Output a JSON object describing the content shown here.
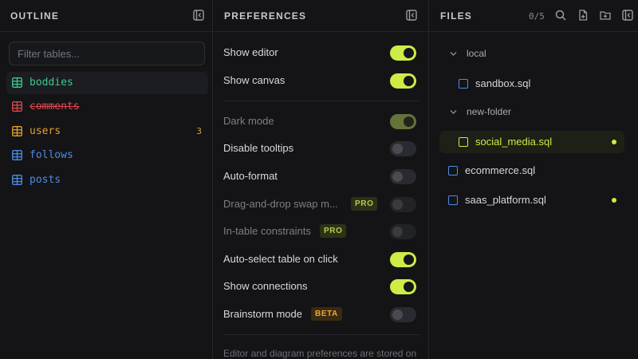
{
  "colors": {
    "background": "#141416",
    "accent": "#cdec46",
    "table_icon_green": "#3ec78a",
    "table_icon_red": "#e0484e",
    "table_icon_orange": "#e0a030",
    "table_icon_blue": "#4d8be8",
    "file_icon_blue": "#4d8be8",
    "pro_badge": "#b6c94e",
    "beta_badge": "#f0a43a"
  },
  "outline": {
    "title": "OUTLINE",
    "collapse_icon": "panel-collapse-icon",
    "filter_placeholder": "Filter tables...",
    "tables": [
      {
        "name": "boddies",
        "color": "#3ec78a",
        "icon": "table-icon",
        "selected": true,
        "strikethrough": false,
        "count": ""
      },
      {
        "name": "comments",
        "color": "#e0484e",
        "icon": "table-icon",
        "selected": false,
        "strikethrough": true,
        "count": ""
      },
      {
        "name": "users",
        "color": "#e0a030",
        "icon": "table-icon",
        "selected": false,
        "strikethrough": false,
        "count": "3"
      },
      {
        "name": "follows",
        "color": "#4d8be8",
        "icon": "table-icon",
        "selected": false,
        "strikethrough": false,
        "count": ""
      },
      {
        "name": "posts",
        "color": "#4d8be8",
        "icon": "table-icon",
        "selected": false,
        "strikethrough": false,
        "count": ""
      }
    ]
  },
  "preferences": {
    "title": "PREFERENCES",
    "collapse_icon": "panel-collapse-icon",
    "items": [
      {
        "label": "Show editor",
        "on": true,
        "disabled": false,
        "badge": ""
      },
      {
        "label": "Show canvas",
        "on": true,
        "disabled": false,
        "badge": ""
      },
      {
        "label": "Dark mode",
        "on": true,
        "disabled": true,
        "badge": ""
      },
      {
        "label": "Disable tooltips",
        "on": false,
        "disabled": false,
        "badge": ""
      },
      {
        "label": "Auto-format",
        "on": false,
        "disabled": false,
        "badge": ""
      },
      {
        "label": "Drag-and-drop swap m...",
        "on": false,
        "disabled": true,
        "badge": "PRO"
      },
      {
        "label": "In-table constraints",
        "on": false,
        "disabled": true,
        "badge": "PRO"
      },
      {
        "label": "Auto-select table on click",
        "on": true,
        "disabled": false,
        "badge": ""
      },
      {
        "label": "Show connections",
        "on": true,
        "disabled": false,
        "badge": ""
      },
      {
        "label": "Brainstorm mode",
        "on": false,
        "disabled": false,
        "badge": "BETA"
      }
    ],
    "footer_note": "Editor and diagram preferences are stored on"
  },
  "files": {
    "title": "FILES",
    "count": "0/5",
    "header_icons": [
      "search-icon",
      "new-file-icon",
      "new-folder-icon",
      "panel-collapse-icon"
    ],
    "tree": [
      {
        "kind": "folder",
        "name": "local",
        "expanded": true
      },
      {
        "kind": "file",
        "name": "sandbox.sql",
        "nested": true,
        "selected": false,
        "modified": false
      },
      {
        "kind": "folder",
        "name": "new-folder",
        "expanded": true
      },
      {
        "kind": "file",
        "name": "social_media.sql",
        "nested": true,
        "selected": true,
        "modified": true
      },
      {
        "kind": "file",
        "name": "ecommerce.sql",
        "nested": false,
        "selected": false,
        "modified": false
      },
      {
        "kind": "file",
        "name": "saas_platform.sql",
        "nested": false,
        "selected": false,
        "modified": true
      }
    ]
  }
}
